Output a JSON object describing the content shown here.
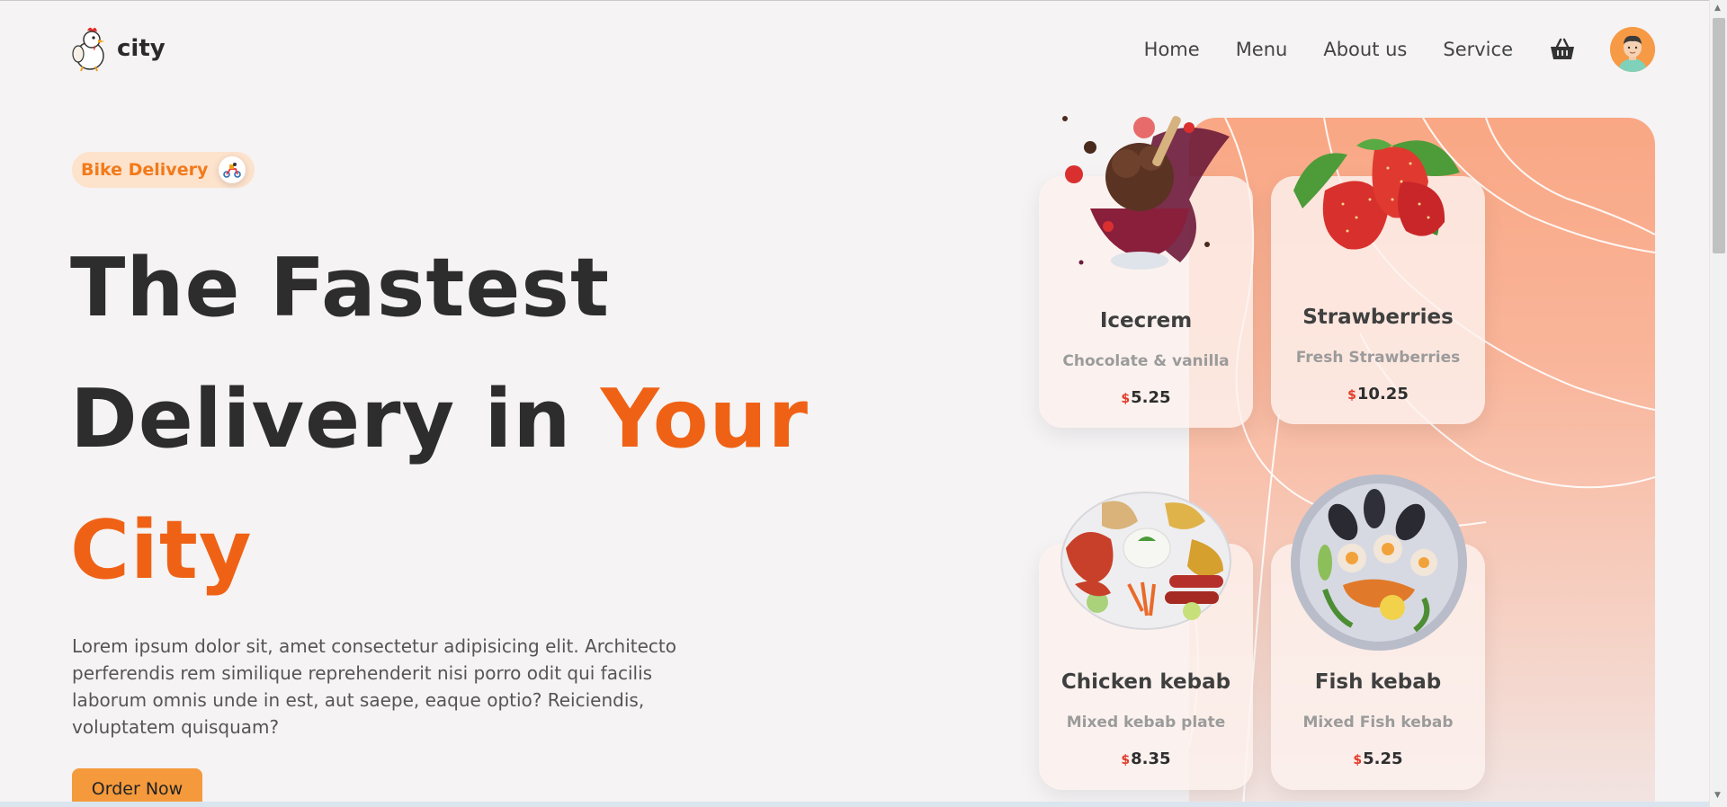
{
  "brand": {
    "name": "city"
  },
  "nav": {
    "items": [
      {
        "label": "Home"
      },
      {
        "label": "Menu"
      },
      {
        "label": "About us"
      },
      {
        "label": "Service"
      }
    ],
    "cart_icon": "basket-icon",
    "avatar_icon": "user-avatar"
  },
  "hero": {
    "badge": "Bike Delivery",
    "badge_icon": "scooter-icon",
    "title_line1": "The Fastest",
    "title_line2_part1": "Delivery in ",
    "title_line2_part2": "Your",
    "title_line3": "City",
    "description": "Lorem ipsum dolor sit, amet consectetur adipisicing elit. Architecto perferendis rem similique reprehenderit nisi porro odit qui facilis laborum omnis unde in est, aut saepe, eaque optio? Reiciendis, voluptatem quisquam?",
    "cta": "Order Now"
  },
  "cards": [
    {
      "name": "Icecrem",
      "subtitle": "Chocolate & vanilla",
      "currency": "$",
      "price": "5.25",
      "image": "icecream-image"
    },
    {
      "name": "Strawberries",
      "subtitle": "Fresh Strawberries",
      "currency": "$",
      "price": "10.25",
      "image": "strawberries-image"
    },
    {
      "name": "Chicken kebab",
      "subtitle": "Mixed kebab plate",
      "currency": "$",
      "price": "8.35",
      "image": "chicken-kebab-image"
    },
    {
      "name": "Fish kebab",
      "subtitle": "Mixed Fish kebab",
      "currency": "$",
      "price": "5.25",
      "image": "fish-kebab-image"
    }
  ],
  "colors": {
    "accent": "#ef6216",
    "badge_bg": "#fde2cc",
    "cta_bg": "#f59a3c",
    "panel": "#f9a784",
    "background": "#f5f3f4"
  }
}
